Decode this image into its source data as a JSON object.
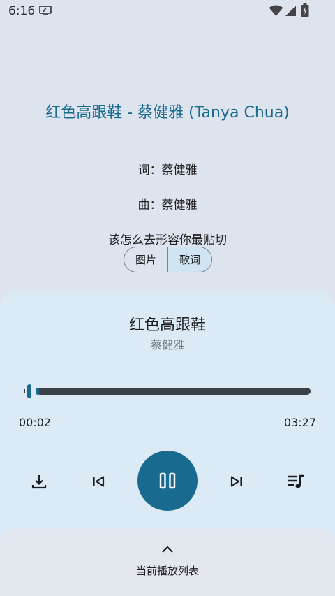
{
  "status_bar": {
    "time": "6:16"
  },
  "lyrics": {
    "header_title": "红色高跟鞋 - 蔡健雅 (Tanya Chua)",
    "lyricist": "词：蔡健雅",
    "composer": "曲：蔡健雅",
    "current_line": "该怎么去形容你最贴切"
  },
  "view_toggle": {
    "options": [
      "图片",
      "歌词"
    ],
    "selected": "歌词"
  },
  "player": {
    "title": "红色高跟鞋",
    "artist": "蔡健雅",
    "elapsed": "00:02",
    "duration": "03:27",
    "progress_fraction": 0.01,
    "state": "playing"
  },
  "playlist": {
    "label": "当前播放列表"
  },
  "icons": {
    "status": [
      "notification-icon",
      "wifi-icon",
      "signal-icon",
      "battery-icon"
    ],
    "controls": [
      "download-icon",
      "skip-previous-icon",
      "pause-icon",
      "skip-next-icon",
      "queue-music-icon"
    ],
    "playlist": "chevron-up-icon"
  },
  "colors": {
    "accent": "#186a8e",
    "background": "#dde4ee",
    "panel": "#dceaf5",
    "track": "#3b4046",
    "toggle_selected": "#cfe5f3"
  }
}
